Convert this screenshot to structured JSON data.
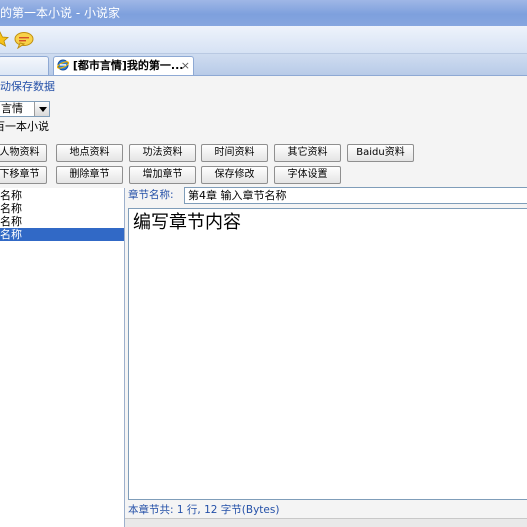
{
  "window": {
    "title": "的第一本小说 - 小说家"
  },
  "tabs": [
    {
      "label": ""
    },
    {
      "label": "[都市言情]我的第一...",
      "close": "×"
    }
  ],
  "autosave_label": "动保存数据",
  "category": {
    "value": "言情"
  },
  "novel_title": "百一本小说",
  "toolbar_row1": [
    "人物资料",
    "地点资料",
    "功法资料",
    "时间资料",
    "其它资料",
    "Baidu资料"
  ],
  "toolbar_row2": [
    "下移章节",
    "删除章节",
    "增加章节",
    "保存修改",
    "字体设置"
  ],
  "chapter_list": [
    "名称",
    "名称",
    "名称",
    "名称"
  ],
  "selected_index": 3,
  "chapter_name_label": "章节名称:",
  "chapter_name_value": "第4章 输入章节名称",
  "editor_text": "编写章节内容",
  "status": "本章节共: 1 行, 12 字节(Bytes)"
}
